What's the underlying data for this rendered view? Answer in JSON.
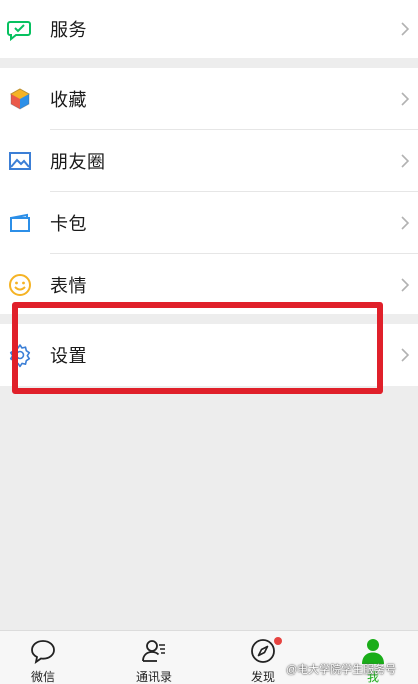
{
  "menu": {
    "services_label": "服务",
    "favorites_label": "收藏",
    "moments_label": "朋友圈",
    "cards_label": "卡包",
    "stickers_label": "表情",
    "settings_label": "设置"
  },
  "tabbar": {
    "chats": "微信",
    "contacts": "通讯录",
    "discover": "发现",
    "me": "我"
  },
  "watermark": "@电大学院学生服务号",
  "colors": {
    "accent_green": "#1aad19",
    "highlight_red": "#e0202a",
    "badge_red": "#e64340"
  },
  "icons": {
    "services": "wallet-check-icon",
    "favorites": "cube-icon",
    "moments": "image-icon",
    "cards": "card-wallet-icon",
    "stickers": "smiley-icon",
    "settings": "gear-icon"
  }
}
